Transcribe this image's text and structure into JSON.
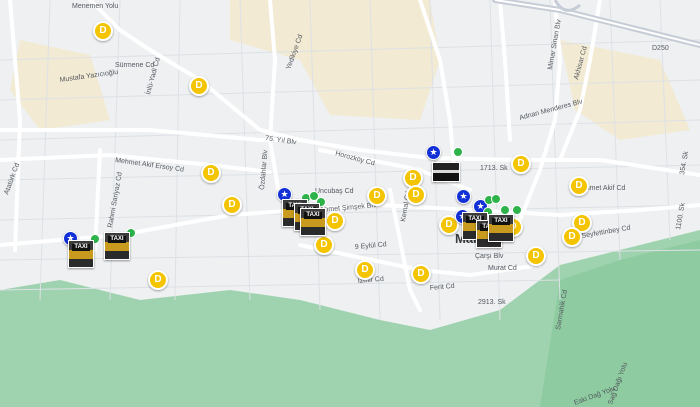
{
  "map": {
    "city": "Manisa",
    "colors": {
      "land": "#eef0f2",
      "green": "#9fd2ae",
      "sand": "#f2ead2",
      "road": "#ffffff",
      "highway": "#c7cdd6",
      "dmarker": "#f5c400",
      "star": "#1230d6",
      "dot": "#2eb34a"
    },
    "streets": [
      "Menemen Yolu",
      "Sürmene Cd",
      "Mustafa Yazıcıoğlu",
      "İnlü-Yadi Cd",
      "Yedikiye Cd",
      "75. Yıl Blv",
      "Horozköy Cd",
      "Mehmet Akif Ersoy Cd",
      "Atatürk Cd",
      "Uncubaş Cd",
      "Ahmet Şimşek Blv",
      "Kemal Cd",
      "9 Eylül Cd",
      "İzmir Cd",
      "Murat Cd",
      "Çarşı Blv",
      "2913. Sk",
      "1713. Sk",
      "Mimar Sinan Blv",
      "Akhisar Cd",
      "Seyfettinbey Cd",
      "Mehmet Akif Cd",
      "354. Sk",
      "Sarmahik Cd",
      "D250",
      "Özdahlar Blv",
      "Rahmi Sariyaz Cd",
      "Adnan Menderes Blv",
      "1100. Sk",
      "Sağ Dağı Yolu",
      "Eski Dağ Yolu",
      "Ferit Cd"
    ],
    "marker_glyphs": {
      "d": "D",
      "star": "★",
      "taxi": "TAXI"
    }
  }
}
